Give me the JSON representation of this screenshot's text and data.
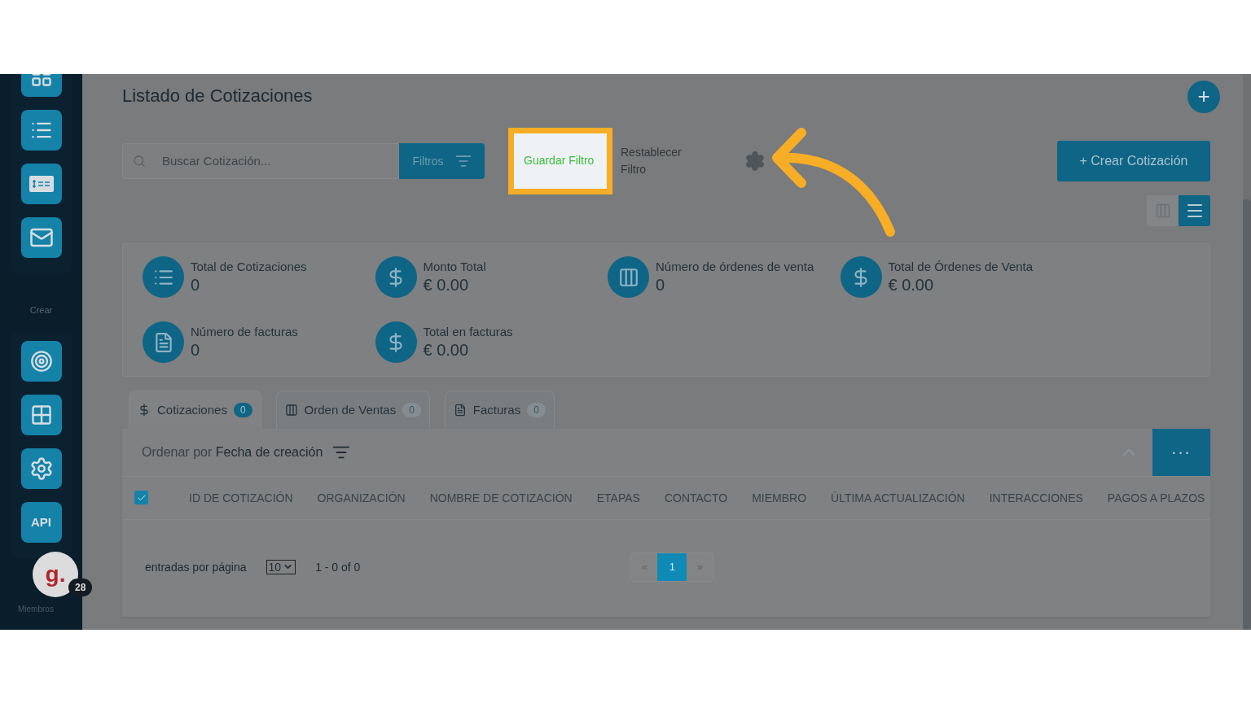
{
  "sidebar": {
    "top_items": [
      {
        "kind": "grid"
      },
      {
        "kind": "list"
      },
      {
        "kind": "invoice"
      },
      {
        "kind": "mail"
      }
    ],
    "section_label": "Crear",
    "create_items": [
      {
        "kind": "target"
      },
      {
        "kind": "apps"
      },
      {
        "kind": "gears"
      },
      {
        "kind": "api",
        "text": "API"
      }
    ],
    "avatar": {
      "letter": "g.",
      "badge": "28"
    },
    "members_label": "Miembros"
  },
  "page": {
    "title": "Listado de Cotizaciones",
    "add_button": "+"
  },
  "toolbar": {
    "search": {
      "placeholder": "Buscar Cotización..."
    },
    "filters_button": "Filtros",
    "save_filter": "Guardar Filtro",
    "reset_filter": "Restablecer Filtro",
    "create_button": "+ Crear Cotización"
  },
  "view_toggle": [
    {
      "kind": "kanban",
      "selected": false
    },
    {
      "kind": "list",
      "selected": true
    }
  ],
  "stats": [
    {
      "kind": "list",
      "label": "Total de Cotizaciones",
      "value": "0"
    },
    {
      "kind": "dollar",
      "label": "Monto Total",
      "value": "€ 0.00"
    },
    {
      "kind": "sales",
      "label": "Número de órdenes de venta",
      "value": "0"
    },
    {
      "kind": "dollar",
      "label": "Total de Órdenes de Venta",
      "value": "€ 0.00"
    },
    {
      "kind": "doc",
      "label": "Número de facturas",
      "value": "0"
    },
    {
      "kind": "dollar",
      "label": "Total en facturas",
      "value": "€ 0.00"
    }
  ],
  "tabs": [
    {
      "kind": "dollar",
      "label": "Cotizaciones",
      "count": "0",
      "selected": true
    },
    {
      "kind": "sales",
      "label": "Orden de Ventas",
      "count": "0",
      "selected": false
    },
    {
      "kind": "doc",
      "label": "Facturas",
      "count": "0",
      "selected": false
    }
  ],
  "sort": {
    "prefix": "Ordenar por",
    "value": "Fecha de creación",
    "more_button": "..."
  },
  "table": {
    "select_all_checked": true,
    "columns": [
      "ID DE COTIZACIÓN",
      "ORGANIZACIÓN",
      "NOMBRE DE COTIZACIÓN",
      "ETAPAS",
      "CONTACTO",
      "MIEMBRO",
      "ÚLTIMA ACTUALIZACIÓN",
      "INTERACCIONES",
      "PAGOS A PLAZOS"
    ]
  },
  "pagination": {
    "entries_label": "entradas por página",
    "per_page": "10",
    "range": "1 - 0 of 0",
    "prev": "«",
    "pages": [
      {
        "label": "1",
        "selected": true
      }
    ],
    "next": "»"
  }
}
